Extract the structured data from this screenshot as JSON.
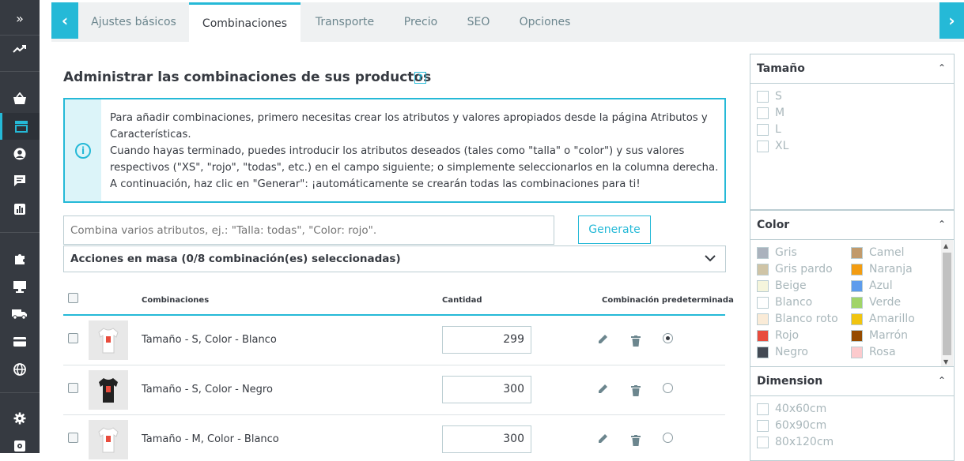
{
  "sidebar": {
    "items": [
      {
        "icon": "double-chevron-right-icon",
        "glyph": "»"
      },
      {
        "icon": "trending-up-icon",
        "glyph": "⟋"
      },
      {
        "icon": "basket-icon",
        "glyph": "⛒"
      },
      {
        "icon": "store-icon",
        "glyph": "▤"
      },
      {
        "icon": "user-icon",
        "glyph": "●"
      },
      {
        "icon": "chat-icon",
        "glyph": "▬"
      },
      {
        "icon": "bar-chart-icon",
        "glyph": "▥"
      },
      {
        "icon": "puzzle-icon",
        "glyph": "✚"
      },
      {
        "icon": "monitor-icon",
        "glyph": "▭"
      },
      {
        "icon": "truck-icon",
        "glyph": "▰"
      },
      {
        "icon": "credit-card-icon",
        "glyph": "▭"
      },
      {
        "icon": "globe-icon",
        "glyph": "◍"
      },
      {
        "icon": "gear-icon",
        "glyph": "⚙"
      },
      {
        "icon": "settings-box-icon",
        "glyph": "⚙"
      }
    ]
  },
  "tabs": {
    "items": [
      "Ajustes básicos",
      "Combinaciones",
      "Transporte",
      "Precio",
      "SEO",
      "Opciones"
    ],
    "active": "Combinaciones"
  },
  "main": {
    "title": "Administrar las combinaciones de sus productos",
    "help": "?",
    "alert": {
      "icon_glyph": "i",
      "line1": "Para añadir combinaciones, primero necesitas crear los atributos y valores apropiados desde la página Atributos y Características.",
      "line2": "Cuando hayas terminado, puedes introducir los atributos deseados (tales como \"talla\" o \"color\") y sus valores respectivos (\"XS\", \"rojo\", \"todas\", etc.) en el campo siguiente; o simplemente seleccionarlos en la columna derecha. A continuación, haz clic en \"Generar\": ¡automáticamente se crearán todas las combinaciones para ti!"
    },
    "combo_placeholder": "Combina varios atributos, ej.: \"Talla: todas\", \"Color: rojo\".",
    "generate_label": "Generate",
    "bulk_label": "Acciones en masa (0/8 combinación(es) seleccionadas)",
    "table": {
      "headers": {
        "combination": "Combinaciones",
        "quantity": "Cantidad",
        "default": "Combinación predeterminada"
      },
      "rows": [
        {
          "name": "Tamaño - S, Color - Blanco",
          "qty": "299",
          "shirt_color": "#ffffff",
          "default": true
        },
        {
          "name": "Tamaño - S, Color - Negro",
          "qty": "300",
          "shirt_color": "#222222",
          "default": false
        },
        {
          "name": "Tamaño - M, Color - Blanco",
          "qty": "300",
          "shirt_color": "#ffffff",
          "default": false
        }
      ]
    }
  },
  "panels": {
    "size": {
      "title": "Tamaño",
      "items": [
        "S",
        "M",
        "L",
        "XL"
      ]
    },
    "color": {
      "title": "Color",
      "left": [
        {
          "name": "Gris",
          "hex": "#aab2bd"
        },
        {
          "name": "Gris pardo",
          "hex": "#cfc4a6"
        },
        {
          "name": "Beige",
          "hex": "#f5f5dc"
        },
        {
          "name": "Blanco",
          "hex": "#ffffff"
        },
        {
          "name": "Blanco roto",
          "hex": "#faebd7"
        },
        {
          "name": "Rojo",
          "hex": "#e84c3d"
        },
        {
          "name": "Negro",
          "hex": "#434a54"
        }
      ],
      "right": [
        {
          "name": "Camel",
          "hex": "#c19a6b"
        },
        {
          "name": "Naranja",
          "hex": "#f39c11"
        },
        {
          "name": "Azul",
          "hex": "#5d9cec"
        },
        {
          "name": "Verde",
          "hex": "#a0d468"
        },
        {
          "name": "Amarillo",
          "hex": "#f1c40f"
        },
        {
          "name": "Marrón",
          "hex": "#964b00"
        },
        {
          "name": "Rosa",
          "hex": "#fccacd"
        }
      ]
    },
    "dimension": {
      "title": "Dimension",
      "items": [
        "40x60cm",
        "60x90cm",
        "80x120cm"
      ]
    }
  },
  "colors": {
    "accent": "#25b9d7",
    "sidebar": "#363a41"
  }
}
